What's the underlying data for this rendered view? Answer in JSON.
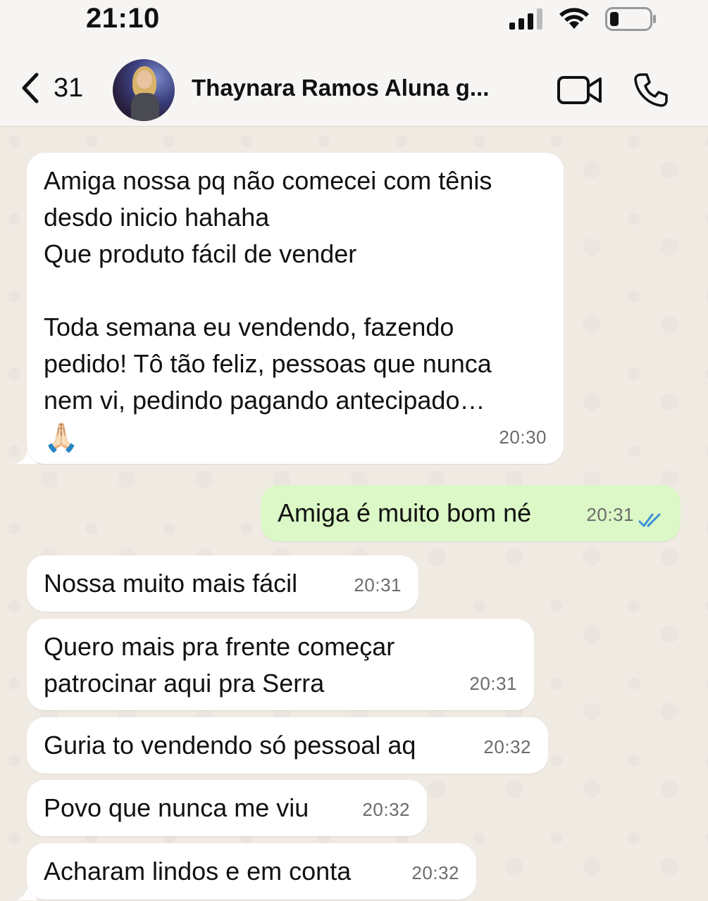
{
  "status_bar": {
    "time": "21:10"
  },
  "header": {
    "back_count": "31",
    "contact_name": "Thaynara Ramos Aluna g..."
  },
  "messages": [
    {
      "direction": "incoming",
      "text": "Amiga nossa pq não comecei com tênis\ndesdo inicio hahaha\nQue produto fácil de vender\n\nToda semana eu vendendo, fazendo\npedido! Tô tão feliz, pessoas que nunca\nnem vi, pedindo pagando antecipado…",
      "emoji": "🙏🏻",
      "time": "20:30"
    },
    {
      "direction": "outgoing",
      "text": "Amiga é muito bom né",
      "time": "20:31",
      "read": true
    },
    {
      "direction": "incoming",
      "text": "Nossa muito mais fácil",
      "time": "20:31"
    },
    {
      "direction": "incoming",
      "text": "Quero mais pra frente começar\npatrocinar aqui pra Serra",
      "time": "20:31"
    },
    {
      "direction": "incoming",
      "text": "Guria to vendendo só pessoal aq",
      "time": "20:32"
    },
    {
      "direction": "incoming",
      "text": "Povo que nunca me viu",
      "time": "20:32"
    },
    {
      "direction": "incoming",
      "text": "Acharam lindos e em conta",
      "time": "20:32"
    }
  ],
  "colors": {
    "incoming_bubble": "#ffffff",
    "outgoing_bubble": "#dbf8c6",
    "chat_background": "#efeae2",
    "read_ticks": "#3a8fd8"
  },
  "icons": [
    "back-chevron-icon",
    "video-call-icon",
    "phone-icon",
    "signal-icon",
    "wifi-icon",
    "battery-icon",
    "double-check-icon"
  ]
}
